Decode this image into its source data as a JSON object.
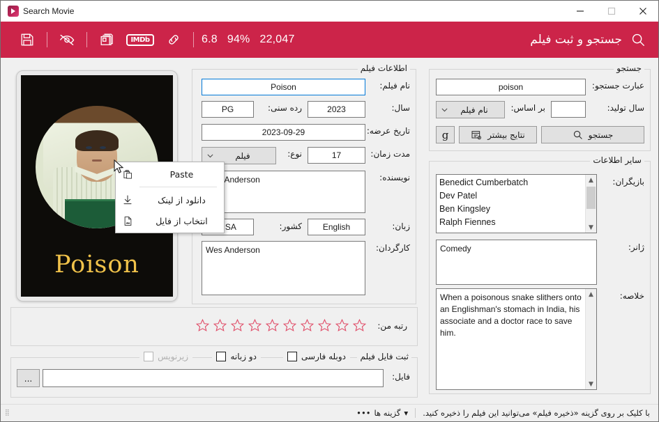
{
  "window": {
    "title": "Search Movie",
    "icon": "play-badge-icon",
    "minimize": "minimize-icon",
    "maximize": "maximize-icon",
    "close": "close-icon"
  },
  "toolbar": {
    "accent_color": "#cc2449",
    "heading": "جستجو و ثبت فیلم",
    "search_icon": "search-icon",
    "save_icon": "save-icon",
    "hide_icon": "eye-off-icon",
    "posters_icon": "cards-icon",
    "imdb_label": "IMDb",
    "link_icon": "link-icon",
    "rating": "6.8",
    "percent": "94%",
    "votes": "22,047"
  },
  "poster": {
    "title": "Poison",
    "title_color": "#f0c24a",
    "background": "#0d0c09"
  },
  "context_menu": {
    "items": [
      {
        "label": "Paste",
        "icon": "clipboard-paste-icon"
      },
      {
        "label": "دانلود از لینک",
        "icon": "download-icon"
      },
      {
        "label": "انتخاب از فایل",
        "icon": "image-file-icon"
      }
    ]
  },
  "film_info": {
    "legend": "اطلاعات فیلم",
    "name_label": "نام فیلم:",
    "name_value": "Poison",
    "year_label": "سال:",
    "year_value": "2023",
    "agerating_label": "رده سنی:",
    "agerating_value": "PG",
    "release_label": "تاریخ عرضه:",
    "release_value": "2023-09-29",
    "duration_label": "مدت زمان:",
    "duration_value": "17",
    "type_label": "نوع:",
    "type_value": "فیلم",
    "writer_label": "نویسنده:",
    "writer_value": "Wes Anderson",
    "language_label": "زبان:",
    "language_value": "English",
    "country_label": "کشور:",
    "country_value": "USA",
    "director_label": "کارگردان:",
    "director_value": "Wes Anderson"
  },
  "search": {
    "legend": "جستجو",
    "query_label": "عبارت جستجو:",
    "query_value": "poison",
    "year_label": "سال تولید:",
    "year_value": "",
    "basis_label": "بر اساس:",
    "basis_value": "نام فیلم",
    "search_button": "جستجو",
    "more_results_button": "نتایج بیشتر",
    "google_button": "g"
  },
  "other_info": {
    "legend": "سایر اطلاعات",
    "actors_label": "بازیگران:",
    "actors": [
      "Benedict Cumberbatch",
      "Dev Patel",
      "Ben Kingsley",
      "Ralph Fiennes"
    ],
    "genre_label": "ژانر:",
    "genre_value": "Comedy",
    "summary_label": "خلاصه:",
    "summary_value": "When a poisonous snake slithers onto an Englishman's stomach in India, his associate and a doctor race to save him."
  },
  "my_rating": {
    "label": "رتبه من:",
    "stars_total": 10,
    "stars_filled": 0,
    "star_color": "#e04a66"
  },
  "film_file": {
    "legend": "ثبت فایل فیلم",
    "dubbed_label": "دوبله فارسی",
    "dubbed_checked": false,
    "bilingual_label": "دو زبانه",
    "bilingual_checked": false,
    "subtitle_label": "زیرنویس",
    "subtitle_checked": false,
    "subtitle_disabled": true,
    "file_label": "فایل:",
    "file_value": "",
    "browse_button": "..."
  },
  "status_bar": {
    "message": "با کلیک بر روی گزینه «ذخیره فیلم» می‌توانید این فیلم را ذخیره کنید.",
    "options_label": "گزینه ها",
    "options_caret": "▾",
    "ellipsis": "•••"
  }
}
